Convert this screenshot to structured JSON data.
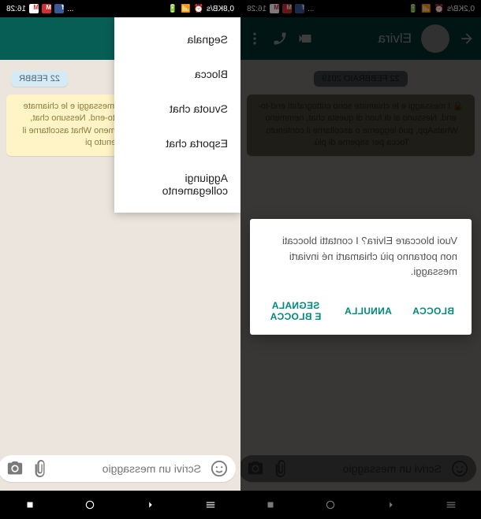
{
  "status": {
    "time": "16:28",
    "net_speed": "0,2KB/s",
    "net_speed_right": "0,8KB/s"
  },
  "header": {
    "contact_name": "Elvira"
  },
  "chat": {
    "date_label": "22 FEBBRAIO 2019",
    "date_label_truncated": "22 FEBBR",
    "encryption_full": "I messaggi e le chiamate sono crittografati end-to-end. Nessuno al di fuori di questa chat, nemmeno WhatsApp, può leggerne o ascoltarne il contenuto. Tocca per saperne di più.",
    "encryption_truncated": "I messaggi e le chiamate end-to-end. Nessuno chat, nemmeno What ascoltarne il contenuto pi"
  },
  "composer": {
    "placeholder": "Scrivi un messaggio"
  },
  "menu": {
    "items": [
      "Segnala",
      "Blocca",
      "Svuota chat",
      "Esporta chat",
      "Aggiungi collegamento"
    ]
  },
  "dialog": {
    "text": "Vuoi bloccare Elvira? I contatti bloccati non potranno più chiamarti né inviarti messaggi.",
    "actions": {
      "report_block": "SEGNALA E BLOCCA",
      "cancel": "ANNULLA",
      "block": "BLOCCA"
    }
  }
}
